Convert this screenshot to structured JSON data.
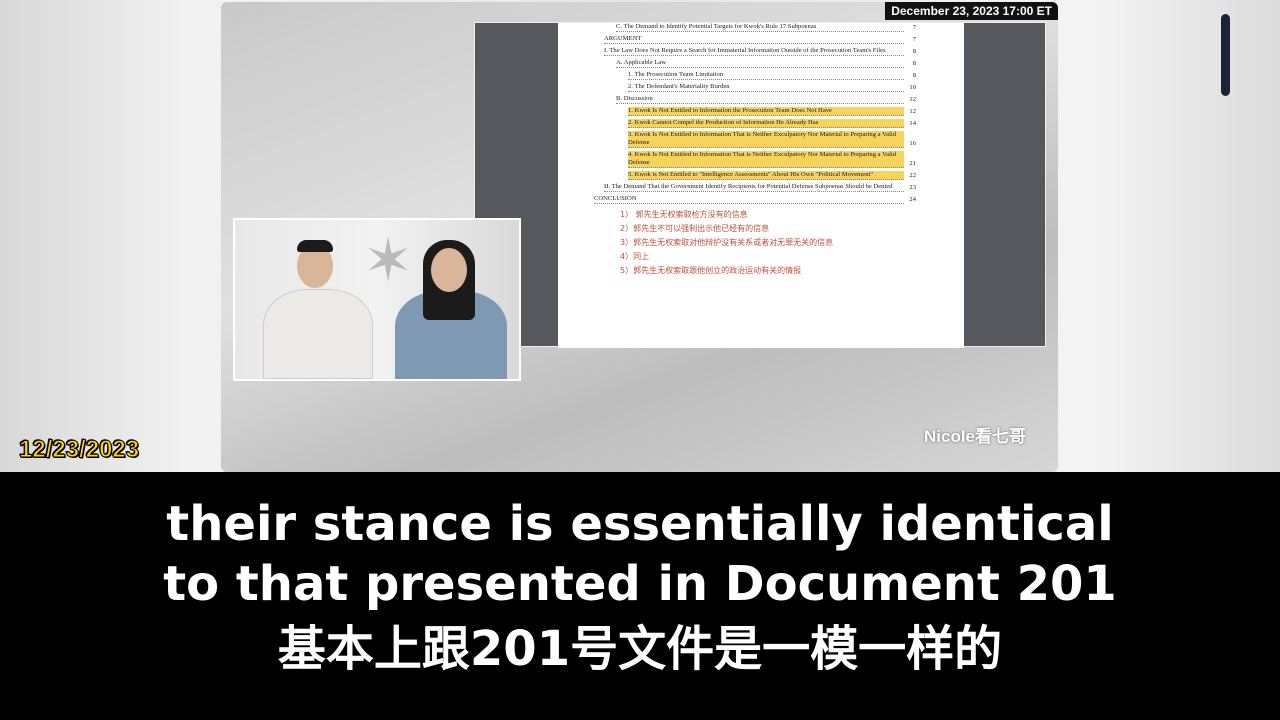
{
  "video": {
    "timestamp": "December 23, 2023 17:00 ET",
    "date_overlay": "12/23/2023",
    "logo": "Nicole看七哥"
  },
  "document": {
    "toc": [
      {
        "text": "C. The Demand to Identify Potential Targets for Kwok's Rule 17 Subpoenas",
        "page": "7",
        "indent": 1,
        "hl": false
      },
      {
        "text": "ARGUMENT",
        "page": "7",
        "indent": 0,
        "hl": false
      },
      {
        "text": "I. The Law Does Not Require a Search for Immaterial Information Outside of the Prosecution Team's Files",
        "page": "8",
        "indent": 0,
        "hl": false
      },
      {
        "text": "A. Applicable Law",
        "page": "8",
        "indent": 1,
        "hl": false
      },
      {
        "text": "1. The Prosecution Team Limitation",
        "page": "8",
        "indent": 2,
        "hl": false
      },
      {
        "text": "2. The Defendant's Materiality Burden",
        "page": "10",
        "indent": 2,
        "hl": false
      },
      {
        "text": "B. Discussion",
        "page": "12",
        "indent": 1,
        "hl": false
      },
      {
        "text": "1. Kwok Is Not Entitled to Information the Prosecution Team Does Not Have",
        "page": "12",
        "indent": 2,
        "hl": true
      },
      {
        "text": "2. Kwok Cannot Compel the Production of Information He Already Has",
        "page": "14",
        "indent": 2,
        "hl": true
      },
      {
        "text": "3. Kwok Is Not Entitled to Information That is Neither Exculpatory Nor Material to Preparing a Valid Defense",
        "page": "16",
        "indent": 2,
        "hl": true
      },
      {
        "text": "4. Kwok Is Not Entitled to Information That is Neither Exculpatory Nor Material to Preparing a Valid Defense",
        "page": "21",
        "indent": 2,
        "hl": true
      },
      {
        "text": "5. Kwok is Not Entitled to \"Intelligence Assessments\" About His Own \"Political Movement\"",
        "page": "22",
        "indent": 2,
        "hl": true
      },
      {
        "text": "II. The Demand That the Government Identify Recipients for Potential Defense Subpoenas Should be Denied",
        "page": "23",
        "indent": 0,
        "hl": false
      },
      {
        "text": "CONCLUSION",
        "page": "24",
        "indent": -1,
        "hl": false
      }
    ],
    "notes": [
      "1） 郭先生无权索取检方没有的信息",
      "2）郭先生不可以强制出示他已经有的信息",
      "3）郭先生无权索取对他辩护没有关系或者对无罪无关的信息",
      "4）同上",
      "5）郭先生无权索取跟他创立的政治运动有关的情报"
    ]
  },
  "subtitles": {
    "line1": "their stance is essentially identical",
    "line2": "to that presented in Document 201",
    "line3": "基本上跟201号文件是一模一样的"
  }
}
